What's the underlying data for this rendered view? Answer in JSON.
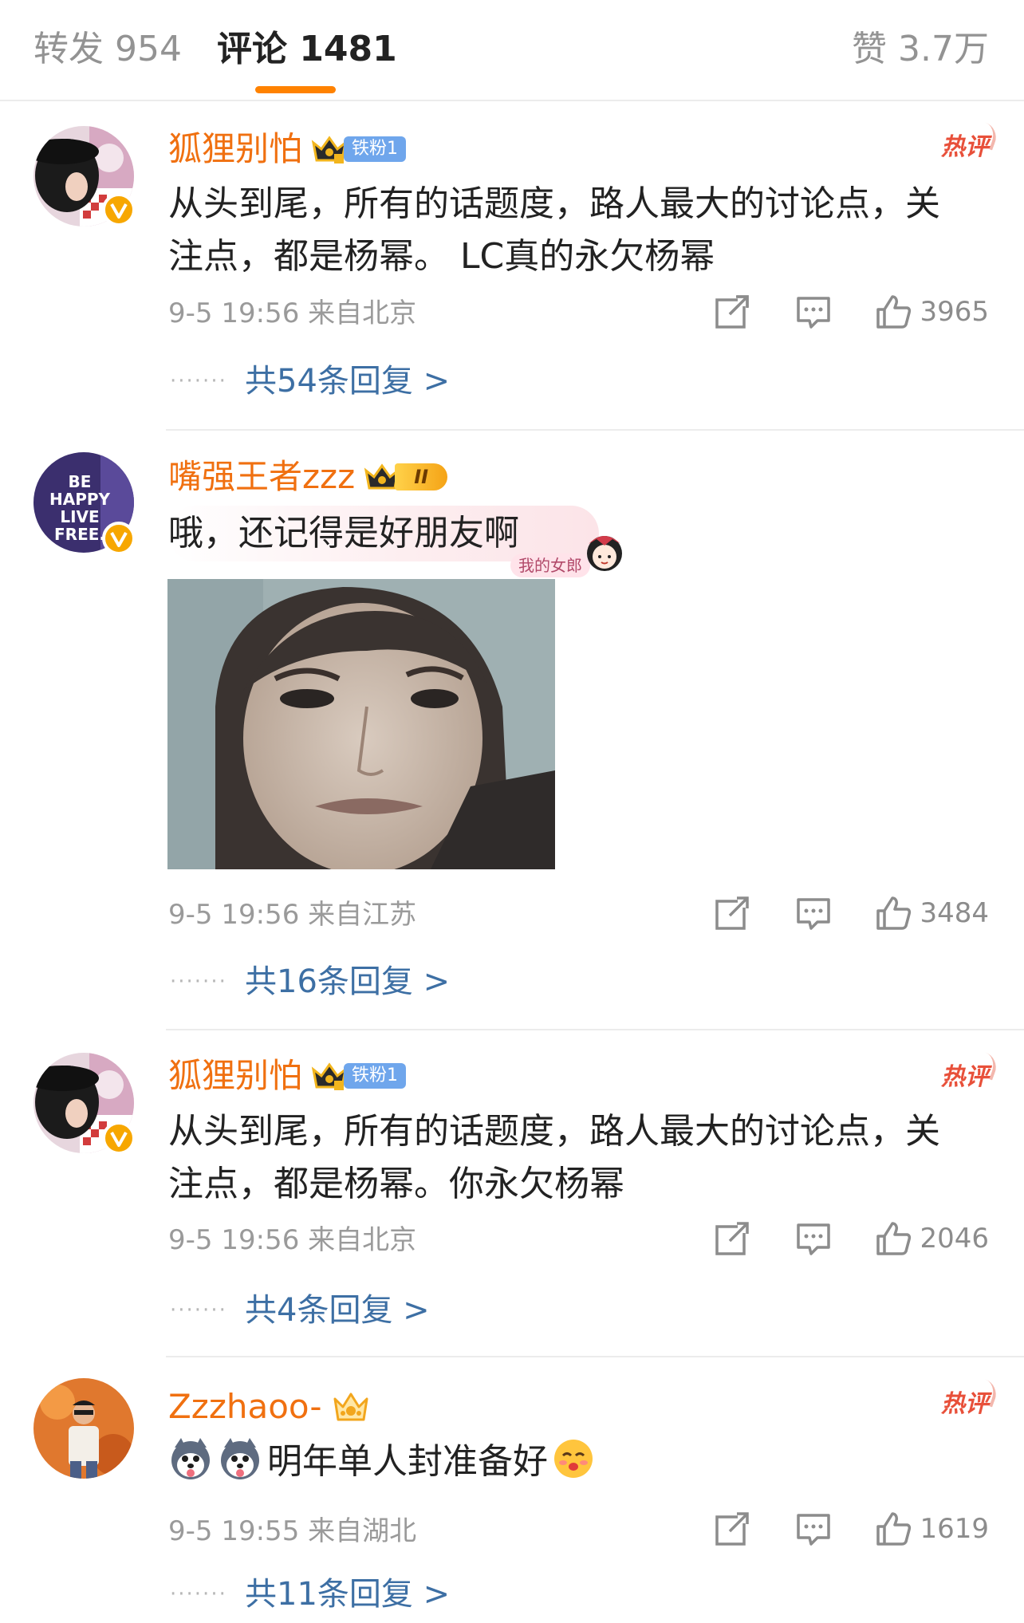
{
  "tabs": {
    "repost": "转发 954",
    "comments": "评论 1481",
    "likes": "赞 3.7万"
  },
  "colors": {
    "accent": "#ff8200",
    "username": "#f07010",
    "link": "#3d6fa4",
    "hot": "#e8503a"
  },
  "comments": [
    {
      "username": "狐狸别怕",
      "fan_badge": "铁粉1",
      "hot_label": "热评",
      "text": "从头到尾，所有的话题度，路人最大的讨论点，关注点，都是杨幂。 LC真的永欠杨幂",
      "meta": "9-5 19:56 来自北京",
      "likes": "3965",
      "replies": "共54条回复 >"
    },
    {
      "username": "嘴强王者zzz",
      "fan_badge": "II",
      "text": "哦，还记得是好朋友啊",
      "bubble_label": "我的女郎",
      "meta": "9-5 19:56 来自江苏",
      "likes": "3484",
      "replies": "共16条回复 >",
      "avatar_text": [
        "BE",
        "HAPPY",
        "LIVE",
        "FREE."
      ]
    },
    {
      "username": "狐狸别怕",
      "fan_badge": "铁粉1",
      "hot_label": "热评",
      "text": "从头到尾，所有的话题度，路人最大的讨论点，关注点，都是杨幂。你永欠杨幂",
      "meta": "9-5 19:56 来自北京",
      "likes": "2046",
      "replies": "共4条回复 >"
    },
    {
      "username": "Zzzhaoo-",
      "hot_label": "热评",
      "text": "明年单人封准备好",
      "meta": "9-5 19:55 来自湖北",
      "likes": "1619",
      "replies": "共11条回复 >"
    }
  ],
  "icons": [
    "share-icon",
    "comment-icon",
    "like-icon",
    "verified-icon",
    "crown-icon"
  ]
}
